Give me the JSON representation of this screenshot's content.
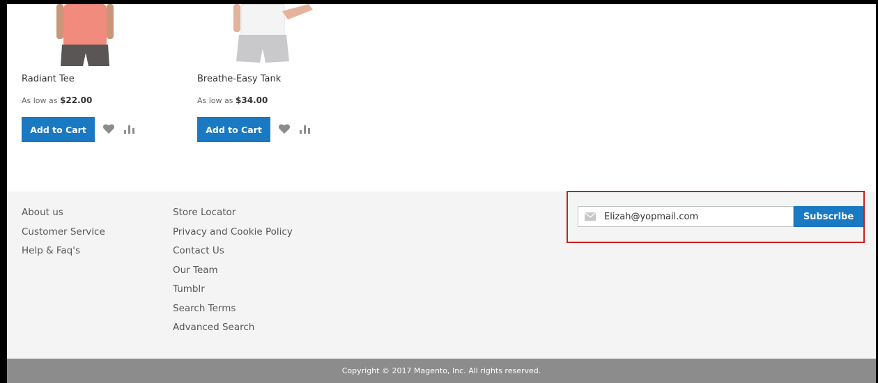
{
  "products": [
    {
      "name": "Radiant Tee",
      "price_prefix": "As low as",
      "price": "$22.00",
      "add_to_cart": "Add to Cart",
      "shirt_color": "#f08b7d"
    },
    {
      "name": "Breathe-Easy Tank",
      "price_prefix": "As low as",
      "price": "$34.00",
      "add_to_cart": "Add to Cart",
      "shirt_color": "#f4f4f4"
    }
  ],
  "footer": {
    "column1": [
      "About us",
      "Customer Service",
      "Help & Faq's"
    ],
    "column2": [
      "Store Locator",
      "Privacy and Cookie Policy",
      "Contact Us",
      "Our Team",
      "Tumblr",
      "Search Terms",
      "Advanced Search"
    ],
    "newsletter": {
      "email_value": "Elizah@yopmail.com",
      "subscribe_label": "Subscribe",
      "icon": "envelope-icon"
    },
    "copyright": "Copyright © 2017 Magento, Inc. All rights reserved."
  },
  "colors": {
    "accent": "#1979c3",
    "highlight": "#cc1f1f",
    "footer_bg": "#f4f4f4",
    "copyright_bg": "#8c8c8c"
  }
}
